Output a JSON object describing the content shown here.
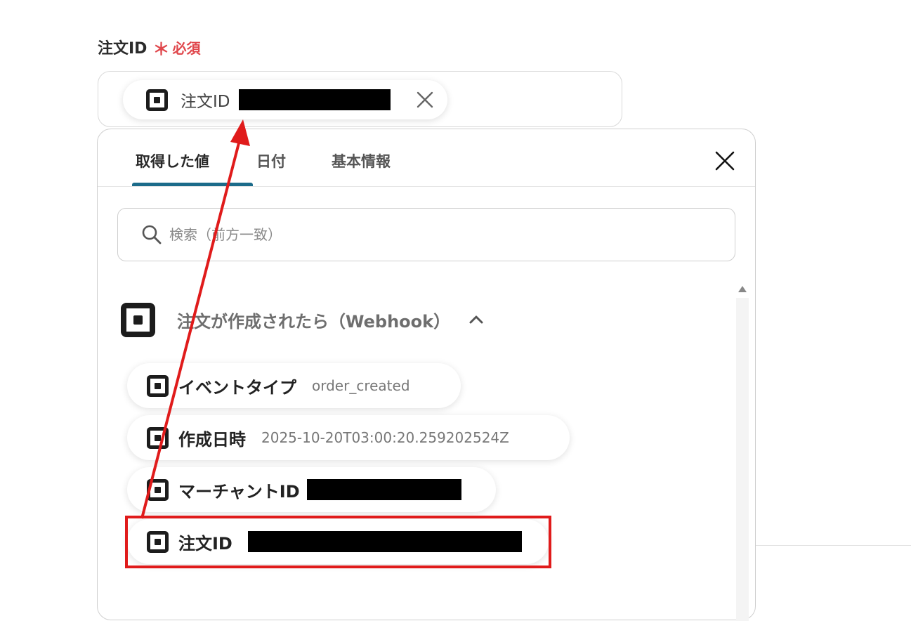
{
  "field": {
    "label": "注文ID",
    "asterisk": "＊",
    "required_text": "必須"
  },
  "selected_chip": {
    "icon": "square-logo-icon",
    "label": "注文ID",
    "value_redacted": true
  },
  "tabs": [
    {
      "label": "取得した値",
      "active": true
    },
    {
      "label": "日付",
      "active": false
    },
    {
      "label": "基本情報",
      "active": false
    }
  ],
  "search": {
    "placeholder": "検索（前方一致）",
    "value": ""
  },
  "group": {
    "icon": "square-logo-icon",
    "title": "注文が作成されたら（Webhook）",
    "expanded": true
  },
  "items": [
    {
      "label": "イベントタイプ",
      "value": "order_created"
    },
    {
      "label": "作成日時",
      "value": "2025-10-20T03:00:20.259202524Z"
    },
    {
      "label": "マーチャントID",
      "value": "",
      "redacted": true
    },
    {
      "label": "注文ID",
      "value": "",
      "redacted": true,
      "highlighted": true
    }
  ],
  "colors": {
    "accent_tab": "#1b6b8a",
    "required": "#e0474c",
    "highlight": "#e01b1b"
  }
}
